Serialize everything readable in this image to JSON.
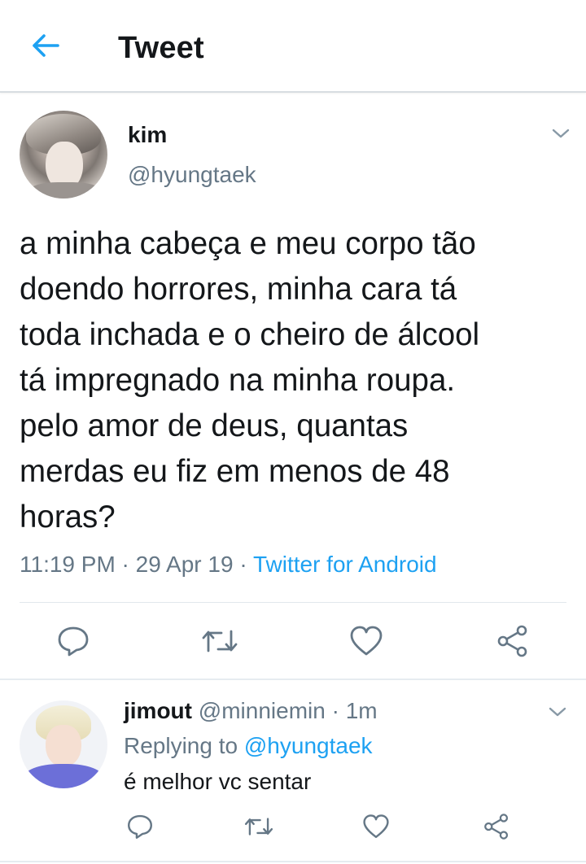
{
  "header": {
    "title": "Tweet",
    "back_icon": "back-arrow-icon",
    "accent_color": "#1da1f2"
  },
  "tweet": {
    "name": "kim",
    "handle": "@hyungtaek",
    "text": "a minha cabeça e meu corpo tão\ndoendo horrores, minha cara tá\ntoda inchada e o cheiro de álcool\ntá impregnado na minha roupa.\npelo amor de deus, quantas\nmerdas eu fiz em menos de 48\nhoras?",
    "time": "11:19 PM",
    "date": "29 Apr 19",
    "separator": " · ",
    "source": "Twitter for Android",
    "actions": [
      "reply-icon",
      "retweet-icon",
      "like-icon",
      "share-icon"
    ]
  },
  "reply": {
    "name": "jimout",
    "handle": "@minniemin",
    "separator": " · ",
    "age": "1m",
    "replying_prefix": "Replying to ",
    "replying_to": "@hyungtaek",
    "text": "é melhor vc sentar",
    "actions": [
      "reply-icon",
      "retweet-icon",
      "like-icon",
      "share-icon"
    ]
  },
  "colors": {
    "text": "#14171a",
    "muted": "#657786",
    "link": "#1da1f2",
    "divider": "#e6ecf0"
  }
}
